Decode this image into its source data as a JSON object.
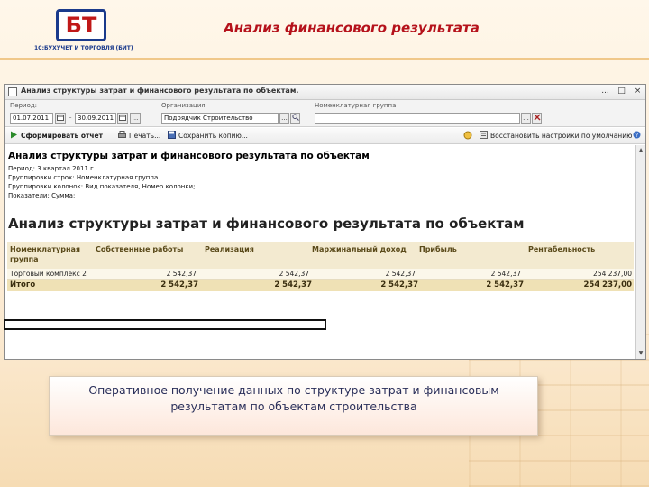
{
  "slide": {
    "title": "Анализ финансового результата",
    "logo_mark": "БТ",
    "logo_text": "1С:БУХУЧЕТ И ТОРГОВЛЯ (БИТ)",
    "caption": "Оперативное получение данных по структуре затрат и финансовым результатам по объектам строительства"
  },
  "window": {
    "title": "Анализ структуры затрат и финансового результата по объектам.",
    "controls": [
      "...",
      "□",
      "×"
    ]
  },
  "params": {
    "period_label": "Период:",
    "date_from": "01.07.2011",
    "date_to": "30.09.2011",
    "dash": "–",
    "dots": "...",
    "org_label": "Организация",
    "org_value": "Подрядчик Строительство",
    "group_label": "Номенклатурная группа",
    "group_value": ""
  },
  "toolbar": {
    "generate": "Сформировать отчет",
    "print": "Печать...",
    "save_copy": "Сохранить копию...",
    "restore": "Восстановить настройки по умолчанию"
  },
  "report": {
    "header": "Анализ структуры затрат и финансового результата по объектам",
    "period_line": "Период: 3 квартал 2011 г.",
    "rows_grouping": "Группировки строк: Номенклатурная группа",
    "cols_grouping": "Группировки колонок: Вид показателя, Номер колонки;",
    "indicators": "Показатели: Сумма;",
    "title": "Анализ структуры затрат и финансового результата по объектам",
    "columns": [
      "Номенклатурная группа",
      "Собственные работы",
      "Реализация",
      "Маржинальный доход",
      "Прибыль",
      "Рентабельность"
    ],
    "rows": [
      {
        "name": "Торговый комплекс 2",
        "values": [
          "2 542,37",
          "2 542,37",
          "2 542,37",
          "2 542,37",
          "254 237,00"
        ]
      }
    ],
    "total": {
      "name": "Итого",
      "values": [
        "2 542,37",
        "2 542,37",
        "2 542,37",
        "2 542,37",
        "254 237,00"
      ]
    }
  },
  "colors": {
    "title_red": "#b5121b",
    "table_header": "#f3ead0",
    "total_row": "#efe1b5"
  }
}
